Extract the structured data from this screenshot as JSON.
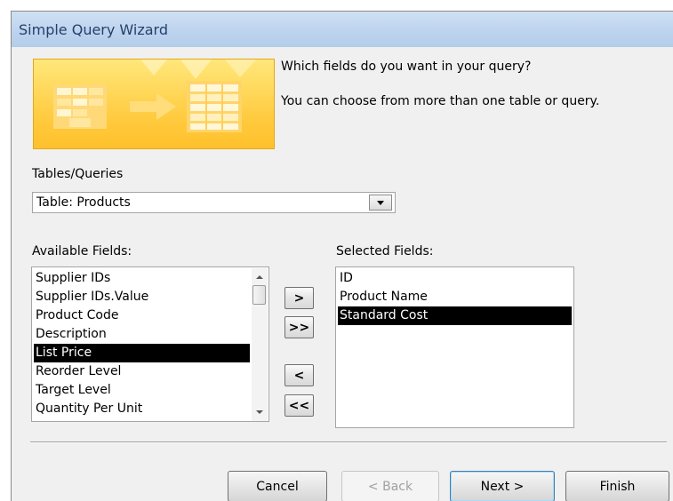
{
  "window": {
    "title": "Simple Query Wizard"
  },
  "intro": {
    "line1": "Which fields do you want in your query?",
    "line2": "You can choose from more than one table or query."
  },
  "tables_queries": {
    "label": "Tables/Queries",
    "selected": "Table: Products"
  },
  "available_fields": {
    "label": "Available Fields:",
    "items": [
      "Supplier IDs",
      "Supplier IDs.Value",
      "Product Code",
      "Description",
      "List Price",
      "Reorder Level",
      "Target Level",
      "Quantity Per Unit"
    ],
    "selected_index": 4
  },
  "selected_fields": {
    "label": "Selected Fields:",
    "items": [
      "ID",
      "Product Name",
      "Standard Cost"
    ],
    "selected_index": 2
  },
  "transfer_buttons": {
    "add_one": ">",
    "add_all": ">>",
    "remove_one": "<",
    "remove_all": "<<"
  },
  "footer_buttons": {
    "cancel": "Cancel",
    "back": "< Back",
    "next": "Next >",
    "finish": "Finish"
  },
  "colors": {
    "illustration": "#ffc93c",
    "selection": "#000000",
    "title_text": "#25416a"
  }
}
